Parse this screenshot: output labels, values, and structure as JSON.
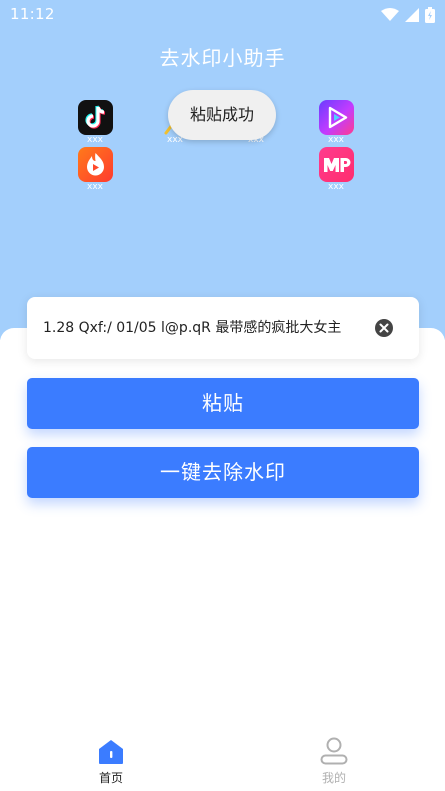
{
  "status_bar": {
    "time": "11:12"
  },
  "app": {
    "title": "去水印小助手"
  },
  "platforms": [
    {
      "icon": "douyin-icon",
      "name": "xxx"
    },
    {
      "icon": "huoshan-icon",
      "name": "xxx"
    },
    {
      "icon": "weishi-icon",
      "name": "xxx"
    },
    {
      "icon": "meipai-icon",
      "name": "xxx"
    },
    {
      "icon": "search-icon",
      "name": "xxx"
    },
    {
      "icon": "hidden-platform-icon",
      "name": "xxx"
    }
  ],
  "toast": {
    "text": "粘贴成功"
  },
  "input": {
    "value": "1.28 Qxf:/ 01/05 l@p.qR 最带感的疯批大女主"
  },
  "buttons": {
    "paste": "粘贴",
    "remove_watermark": "一键去除水印"
  },
  "tabs": [
    {
      "label": "首页",
      "icon": "home-icon",
      "active": true
    },
    {
      "label": "我的",
      "icon": "profile-icon",
      "active": false
    }
  ],
  "colors": {
    "header_bg": "#a3cffc",
    "primary": "#3b7cff",
    "tab_active": "#3b7cff",
    "tab_inactive": "#b0b0b0"
  }
}
